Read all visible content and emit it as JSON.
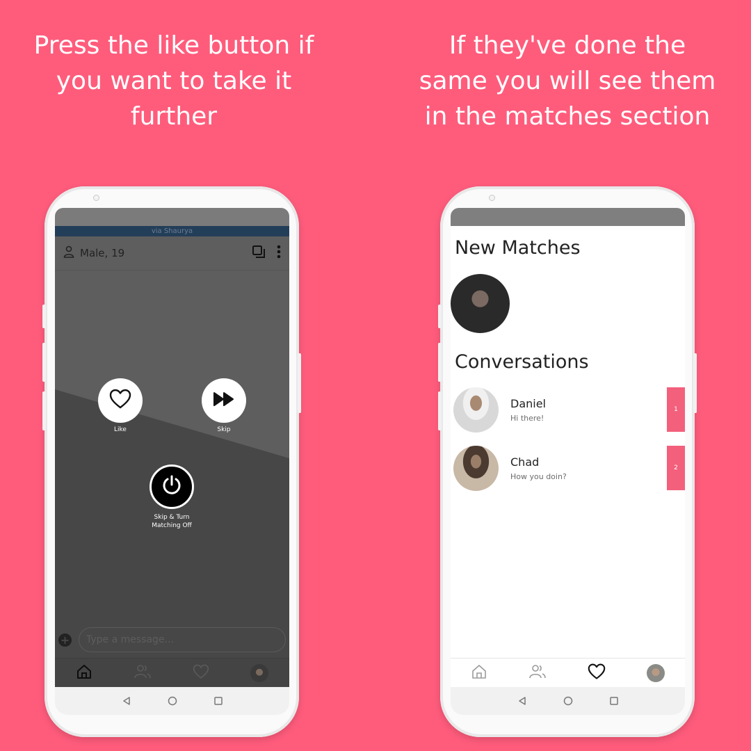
{
  "captions": {
    "left": "Press the like button if you want to take it further",
    "right": "If they've done the same you will see them in the matches section"
  },
  "screen1": {
    "via": "via Shaurya",
    "profile": "Male, 19",
    "like_label": "Like",
    "skip_label": "Skip",
    "power_label_line1": "Skip & Turn",
    "power_label_line2": "Matching Off",
    "message_placeholder": "Type a message..."
  },
  "screen2": {
    "new_matches_title": "New Matches",
    "conversations_title": "Conversations",
    "conversations": [
      {
        "name": "Daniel",
        "message": "Hi there!",
        "badge": "1"
      },
      {
        "name": "Chad",
        "message": "How you doin?",
        "badge": "2"
      }
    ]
  },
  "colors": {
    "background": "#ff5c7c",
    "accent": "#f3607c"
  }
}
